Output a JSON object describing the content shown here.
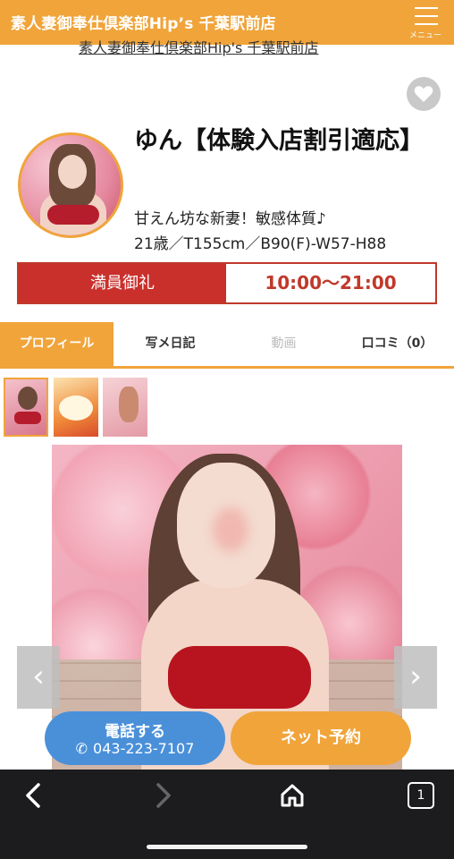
{
  "header": {
    "title": "素人妻御奉仕倶楽部Hip’s 千葉駅前店",
    "menu_label": "メニュー",
    "subtitle_cut": "素人妻御奉仕倶楽部Hip's 千葉駅前店"
  },
  "profile": {
    "name": "ゆん【体験入店割引適応】",
    "catchphrase": "甘えん坊な新妻！敏感体質♪",
    "spec": "21歳／T155cm／B90(F)-W57-H88",
    "status_label": "満員御礼",
    "hours": "10:00〜21:00"
  },
  "tabs": [
    {
      "label": "プロフィール",
      "state": "active"
    },
    {
      "label": "写メ日記",
      "state": "normal"
    },
    {
      "label": "動画",
      "state": "disabled"
    },
    {
      "label": "口コミ（0）",
      "state": "normal"
    }
  ],
  "icons": {
    "favorite": "heart-icon",
    "prev": "chevron-left-icon",
    "next": "chevron-right-icon",
    "phone": "phone-icon"
  },
  "actions": {
    "call_label": "電話する",
    "phone_number": "043-223-7107",
    "reserve_label": "ネット予約"
  },
  "browser": {
    "tab_count": "1"
  },
  "colors": {
    "accent": "#f0a43a",
    "status_red": "#c9302c",
    "call_blue": "#4a90d9"
  }
}
